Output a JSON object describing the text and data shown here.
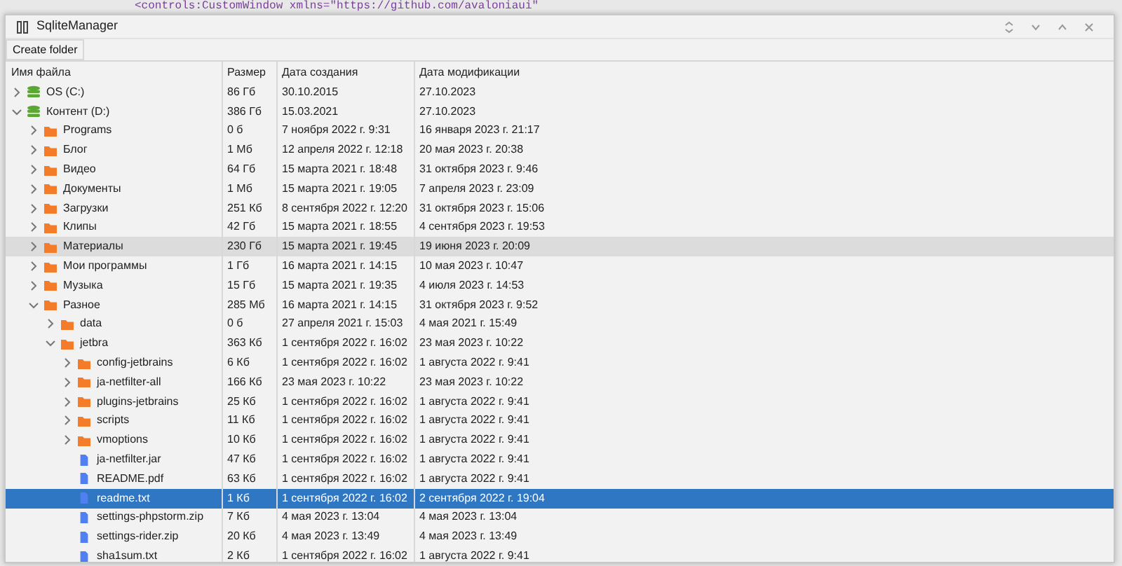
{
  "editor_line": "<controls:CustomWindow xmlns=\"https://github.com/avaloniaui\"",
  "window": {
    "title": "SqliteManager"
  },
  "toolbar": {
    "buttons": [
      "Create folder"
    ]
  },
  "table": {
    "columns": [
      "Имя файла",
      "Размер",
      "Дата создания",
      "Дата модификации"
    ],
    "rows": [
      {
        "kind": "drive",
        "name": "OS (C:)",
        "size": "86 Гб",
        "created": "30.10.2015",
        "modified": "27.10.2023",
        "expanded": false,
        "selected": false,
        "hovered": false
      },
      {
        "kind": "drive",
        "name": "Контент (D:)",
        "size": "386 Гб",
        "created": "15.03.2021",
        "modified": "27.10.2023",
        "expanded": true,
        "selected": false,
        "hovered": false,
        "children": [
          {
            "kind": "folder",
            "name": "Programs",
            "size": "0 б",
            "created": "7 ноября 2022 г. 9:31",
            "modified": "16 января 2023 г. 21:17",
            "expanded": false,
            "selected": false,
            "hovered": false
          },
          {
            "kind": "folder",
            "name": "Блог",
            "size": "1 Мб",
            "created": "12 апреля 2022 г. 12:18",
            "modified": "20 мая 2023 г. 20:38",
            "expanded": false,
            "selected": false,
            "hovered": false
          },
          {
            "kind": "folder",
            "name": "Видео",
            "size": "64 Гб",
            "created": "15 марта 2021 г. 18:48",
            "modified": "31 октября 2023 г. 9:46",
            "expanded": false,
            "selected": false,
            "hovered": false
          },
          {
            "kind": "folder",
            "name": "Документы",
            "size": "1 Мб",
            "created": "15 марта 2021 г. 19:05",
            "modified": "7 апреля 2023 г. 23:09",
            "expanded": false,
            "selected": false,
            "hovered": false
          },
          {
            "kind": "folder",
            "name": "Загрузки",
            "size": "251 Кб",
            "created": "8 сентября 2022 г. 12:20",
            "modified": "31 октября 2023 г. 15:06",
            "expanded": false,
            "selected": false,
            "hovered": false
          },
          {
            "kind": "folder",
            "name": "Клипы",
            "size": "42 Гб",
            "created": "15 марта 2021 г. 18:55",
            "modified": "4 сентября 2023 г. 19:53",
            "expanded": false,
            "selected": false,
            "hovered": false
          },
          {
            "kind": "folder",
            "name": "Материалы",
            "size": "230 Гб",
            "created": "15 марта 2021 г. 19:45",
            "modified": "19 июня 2023 г. 20:09",
            "expanded": false,
            "selected": false,
            "hovered": true
          },
          {
            "kind": "folder",
            "name": "Мои программы",
            "size": "1 Гб",
            "created": "16 марта 2021 г. 14:15",
            "modified": "10 мая 2023 г. 10:47",
            "expanded": false,
            "selected": false,
            "hovered": false
          },
          {
            "kind": "folder",
            "name": "Музыка",
            "size": "15 Гб",
            "created": "15 марта 2021 г. 19:35",
            "modified": "4 июля 2023 г. 14:53",
            "expanded": false,
            "selected": false,
            "hovered": false
          },
          {
            "kind": "folder",
            "name": "Разное",
            "size": "285 Мб",
            "created": "16 марта 2021 г. 14:15",
            "modified": "31 октября 2023 г. 9:52",
            "expanded": true,
            "selected": false,
            "hovered": false,
            "children": [
              {
                "kind": "folder",
                "name": "data",
                "size": "0 б",
                "created": "27 апреля 2021 г. 15:03",
                "modified": "4 мая 2021 г. 15:49",
                "expanded": false,
                "selected": false,
                "hovered": false
              },
              {
                "kind": "folder",
                "name": "jetbra",
                "size": "363 Кб",
                "created": "1 сентября 2022 г. 16:02",
                "modified": "23 мая 2023 г. 10:22",
                "expanded": true,
                "selected": false,
                "hovered": false,
                "children": [
                  {
                    "kind": "folder",
                    "name": "config-jetbrains",
                    "size": "6 Кб",
                    "created": "1 сентября 2022 г. 16:02",
                    "modified": "1 августа 2022 г. 9:41",
                    "expanded": false,
                    "selected": false,
                    "hovered": false
                  },
                  {
                    "kind": "folder",
                    "name": "ja-netfilter-all",
                    "size": "166 Кб",
                    "created": "23 мая 2023 г. 10:22",
                    "modified": "23 мая 2023 г. 10:22",
                    "expanded": false,
                    "selected": false,
                    "hovered": false
                  },
                  {
                    "kind": "folder",
                    "name": "plugins-jetbrains",
                    "size": "25 Кб",
                    "created": "1 сентября 2022 г. 16:02",
                    "modified": "1 августа 2022 г. 9:41",
                    "expanded": false,
                    "selected": false,
                    "hovered": false
                  },
                  {
                    "kind": "folder",
                    "name": "scripts",
                    "size": "11 Кб",
                    "created": "1 сентября 2022 г. 16:02",
                    "modified": "1 августа 2022 г. 9:41",
                    "expanded": false,
                    "selected": false,
                    "hovered": false
                  },
                  {
                    "kind": "folder",
                    "name": "vmoptions",
                    "size": "10 Кб",
                    "created": "1 сентября 2022 г. 16:02",
                    "modified": "1 августа 2022 г. 9:41",
                    "expanded": false,
                    "selected": false,
                    "hovered": false
                  },
                  {
                    "kind": "file",
                    "name": "ja-netfilter.jar",
                    "size": "47 Кб",
                    "created": "1 сентября 2022 г. 16:02",
                    "modified": "1 августа 2022 г. 9:41",
                    "selected": false,
                    "hovered": false
                  },
                  {
                    "kind": "file",
                    "name": "README.pdf",
                    "size": "63 Кб",
                    "created": "1 сентября 2022 г. 16:02",
                    "modified": "1 августа 2022 г. 9:41",
                    "selected": false,
                    "hovered": false
                  },
                  {
                    "kind": "file",
                    "name": "readme.txt",
                    "size": "1 Кб",
                    "created": "1 сентября 2022 г. 16:02",
                    "modified": "2 сентября 2022 г. 19:04",
                    "selected": true,
                    "hovered": false
                  },
                  {
                    "kind": "file",
                    "name": "settings-phpstorm.zip",
                    "size": "7 Кб",
                    "created": "4 мая 2023 г. 13:04",
                    "modified": "4 мая 2023 г. 13:04",
                    "selected": false,
                    "hovered": false
                  },
                  {
                    "kind": "file",
                    "name": "settings-rider.zip",
                    "size": "20 Кб",
                    "created": "4 мая 2023 г. 13:49",
                    "modified": "4 мая 2023 г. 13:49",
                    "selected": false,
                    "hovered": false
                  },
                  {
                    "kind": "file",
                    "name": "sha1sum.txt",
                    "size": "2 Кб",
                    "created": "1 сентября 2022 г. 16:02",
                    "modified": "1 августа 2022 г. 9:41",
                    "selected": false,
                    "hovered": false
                  }
                ]
              }
            ]
          }
        ]
      }
    ]
  }
}
